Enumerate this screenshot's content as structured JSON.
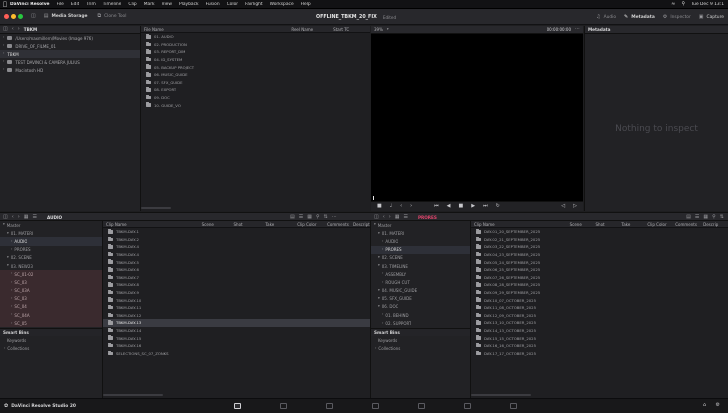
{
  "menubar": {
    "apple": "",
    "items": [
      "DaVinci Resolve",
      "File",
      "Edit",
      "Trim",
      "Timeline",
      "Clip",
      "Mark",
      "View",
      "Playback",
      "Fusion",
      "Color",
      "Fairlight",
      "Workspace",
      "Help"
    ],
    "clock": "Tue Dec 9  13:1"
  },
  "toolbar": {
    "media_storage": "Media Storage",
    "clone_tool": "Clone Tool",
    "project_title": "OFFLINE_TBKM_20_FIX",
    "edited": "Edited",
    "audio": "Audio",
    "metadata": "Metadata",
    "inspector": "Inspector",
    "capture": "Capture",
    "colors": {
      "close": "#ff5f57",
      "min": "#febc2e",
      "max": "#28c840"
    }
  },
  "storage": {
    "path": "TBKM",
    "tree": [
      {
        "label": "/Users/maxmillern/Movies (Image 976)",
        "selected": false
      },
      {
        "label": "DRIVE_OF_FILME_01",
        "selected": false
      },
      {
        "label": "TBKM",
        "selected": true
      },
      {
        "label": "TEST DAVINCI & CAMERA JULIUS",
        "selected": false
      },
      {
        "label": "Macintosh HD",
        "selected": false
      }
    ],
    "columns": [
      "File Name",
      "Reel Name",
      "Start TC"
    ],
    "files": [
      "01. AUDIO",
      "02. PRODUCTION",
      "03. REPORT_DIM",
      "04. ID_SYSTEM",
      "05. BACKUP PROJECT",
      "06. MUSIC_GUIDE",
      "07. SFX_GUIDE",
      "08. EXPORT",
      "09. DOC",
      "10. GUIDE_VO"
    ]
  },
  "viewer": {
    "zoom": "39%",
    "timecode": "00:00:00:00"
  },
  "metadata_panel": {
    "title": "Metadata",
    "empty": "Nothing to inspect"
  },
  "pool": {
    "current_bin": "AUDIO",
    "right_bin": "PRORES",
    "master_label": "Master",
    "bins": [
      {
        "label": "01. MATERI",
        "indent": 1,
        "state": "normal"
      },
      {
        "label": "AUDIO",
        "indent": 2,
        "state": "selected"
      },
      {
        "label": "PRORES",
        "indent": 2,
        "state": "normal"
      },
      {
        "label": "02. SCENE",
        "indent": 1,
        "state": "normal"
      },
      {
        "label": "03. NEW23",
        "indent": 1,
        "state": "normal"
      },
      {
        "label": "SC_01-02",
        "indent": 2,
        "state": "red"
      },
      {
        "label": "SC_03",
        "indent": 2,
        "state": "red"
      },
      {
        "label": "SC_03A",
        "indent": 2,
        "state": "red"
      },
      {
        "label": "SC_03",
        "indent": 2,
        "state": "red"
      },
      {
        "label": "SC_04",
        "indent": 2,
        "state": "red"
      },
      {
        "label": "SC_04A",
        "indent": 2,
        "state": "red"
      },
      {
        "label": "SC_05",
        "indent": 2,
        "state": "red"
      }
    ],
    "smart_bins": "Smart Bins",
    "keywords": "Keywords",
    "collections": "Collections",
    "columns": [
      "Clip Name",
      "Scene",
      "Shot",
      "Take",
      "Clip Color",
      "Comments",
      "Description"
    ],
    "clips": [
      "TBKM-DAY-1",
      "TBKM-DAY-2",
      "TBKM-DAY-4",
      "TBKM-DAY-4",
      "TBKM-DAY-5",
      "TBKM-DAY-6",
      "TBKM-DAY-7",
      "TBKM-DAY-8",
      "TBKM-DAY-9",
      "TBKM-DAY-10",
      "TBKM-DAY-11",
      "TBKM-DAY-12",
      "TBKM-DAY-13",
      "TBKM-DAY-14",
      "TBKM-DAY-15",
      "TBKM-DAY-16",
      "SELECTIONS_SC_07_ZONKS"
    ],
    "selected_clip_index": 12,
    "bins2": [
      {
        "label": "01. MATERI",
        "indent": 1,
        "state": "normal"
      },
      {
        "label": "AUDIO",
        "indent": 2,
        "state": "normal"
      },
      {
        "label": "PRORES",
        "indent": 2,
        "state": "selected"
      },
      {
        "label": "02. SCENE",
        "indent": 1,
        "state": "normal"
      },
      {
        "label": "03. TIMELINE",
        "indent": 1,
        "state": "normal"
      },
      {
        "label": "ASSEMBLY",
        "indent": 2,
        "state": "normal"
      },
      {
        "label": "ROUGH CUT",
        "indent": 2,
        "state": "normal"
      },
      {
        "label": "04. MUSIC_GUIDE",
        "indent": 1,
        "state": "normal"
      },
      {
        "label": "05. SFX_GUIDE",
        "indent": 1,
        "state": "normal"
      },
      {
        "label": "06. DOC",
        "indent": 1,
        "state": "normal"
      },
      {
        "label": "01. BEHIND",
        "indent": 2,
        "state": "normal"
      },
      {
        "label": "02. SUPPORT",
        "indent": 2,
        "state": "normal"
      }
    ],
    "columns2": [
      "Clip Name",
      "Scene",
      "Shot",
      "Take",
      "Clip Color",
      "Comments",
      "Descrip"
    ],
    "clips2": [
      "DAY-01_20_SEPTEMBER_2025",
      "DAY-02_21_SEPTEMBER_2025",
      "DAY-03_22_SEPTEMBER_2025",
      "DAY-04_23_SEPTEMBER_2025",
      "DAY-05_24_SEPTEMBER_2025",
      "DAY-06_25_SEPTEMBER_2025",
      "DAY-07_26_SEPTEMBER_2025",
      "DAY-08_28_SEPTEMBER_2025",
      "DAY-09_29_SEPTEMBER_2025",
      "DAY-10_07_OCTOBER_2025",
      "DAY-11_08_OCTOBER_2025",
      "DAY-12_09_OCTOBER_2025",
      "DAY-13_10_OCTOBER_2025",
      "DAY-14_13_OCTOBER_2025",
      "DAY-15_15_OCTOBER_2025",
      "DAY-16_16_OCTOBER_2025",
      "DAY-17_17_OCTOBER_2025"
    ]
  },
  "dock": {
    "app_name": "DaVinci Resolve Studio 20"
  },
  "colors": {
    "accent_red": "#e0446c",
    "selection": "#3a3b42",
    "panel": "#222225"
  }
}
